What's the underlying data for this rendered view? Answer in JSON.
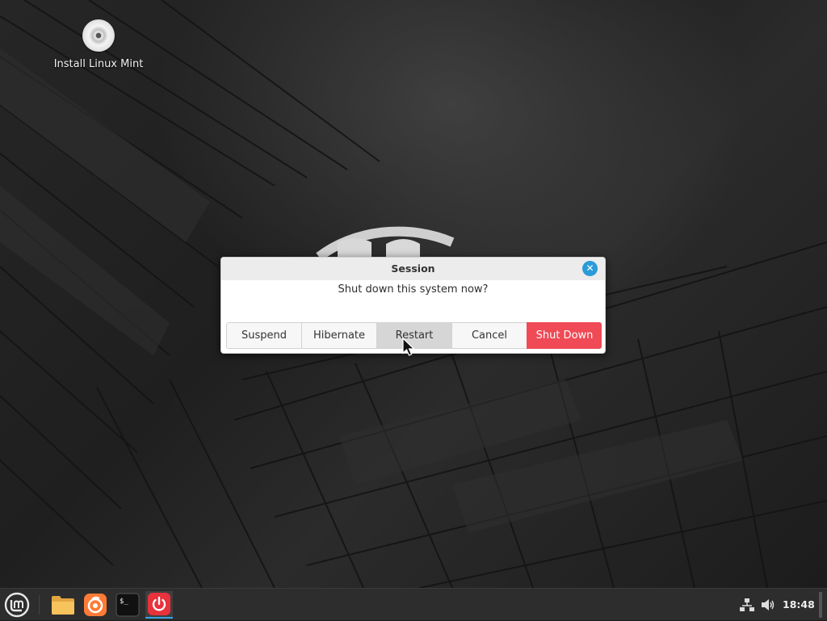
{
  "desktop": {
    "icons": [
      {
        "label": "Install Linux Mint",
        "icon": "disc-icon"
      }
    ]
  },
  "dialog": {
    "title": "Session",
    "message": "Shut down this system now?",
    "buttons": [
      {
        "label": "Suspend"
      },
      {
        "label": "Hibernate"
      },
      {
        "label": "Restart",
        "state": "hovered"
      },
      {
        "label": "Cancel"
      },
      {
        "label": "Shut Down",
        "style": "destructive"
      }
    ],
    "accent_color": "#2b9bd8",
    "destructive_color": "#ef4a55"
  },
  "panel": {
    "menu_icon": "linux-mint-logo-icon",
    "launchers": [
      {
        "name": "file-manager-icon"
      },
      {
        "name": "firefox-icon"
      },
      {
        "name": "terminal-icon",
        "text": "$_"
      },
      {
        "name": "power-icon",
        "active": true
      }
    ],
    "tray": {
      "network_icon": "network-icon",
      "volume_icon": "volume-icon",
      "clock": "18:48"
    },
    "active_indicator_color": "#35a7e8"
  }
}
